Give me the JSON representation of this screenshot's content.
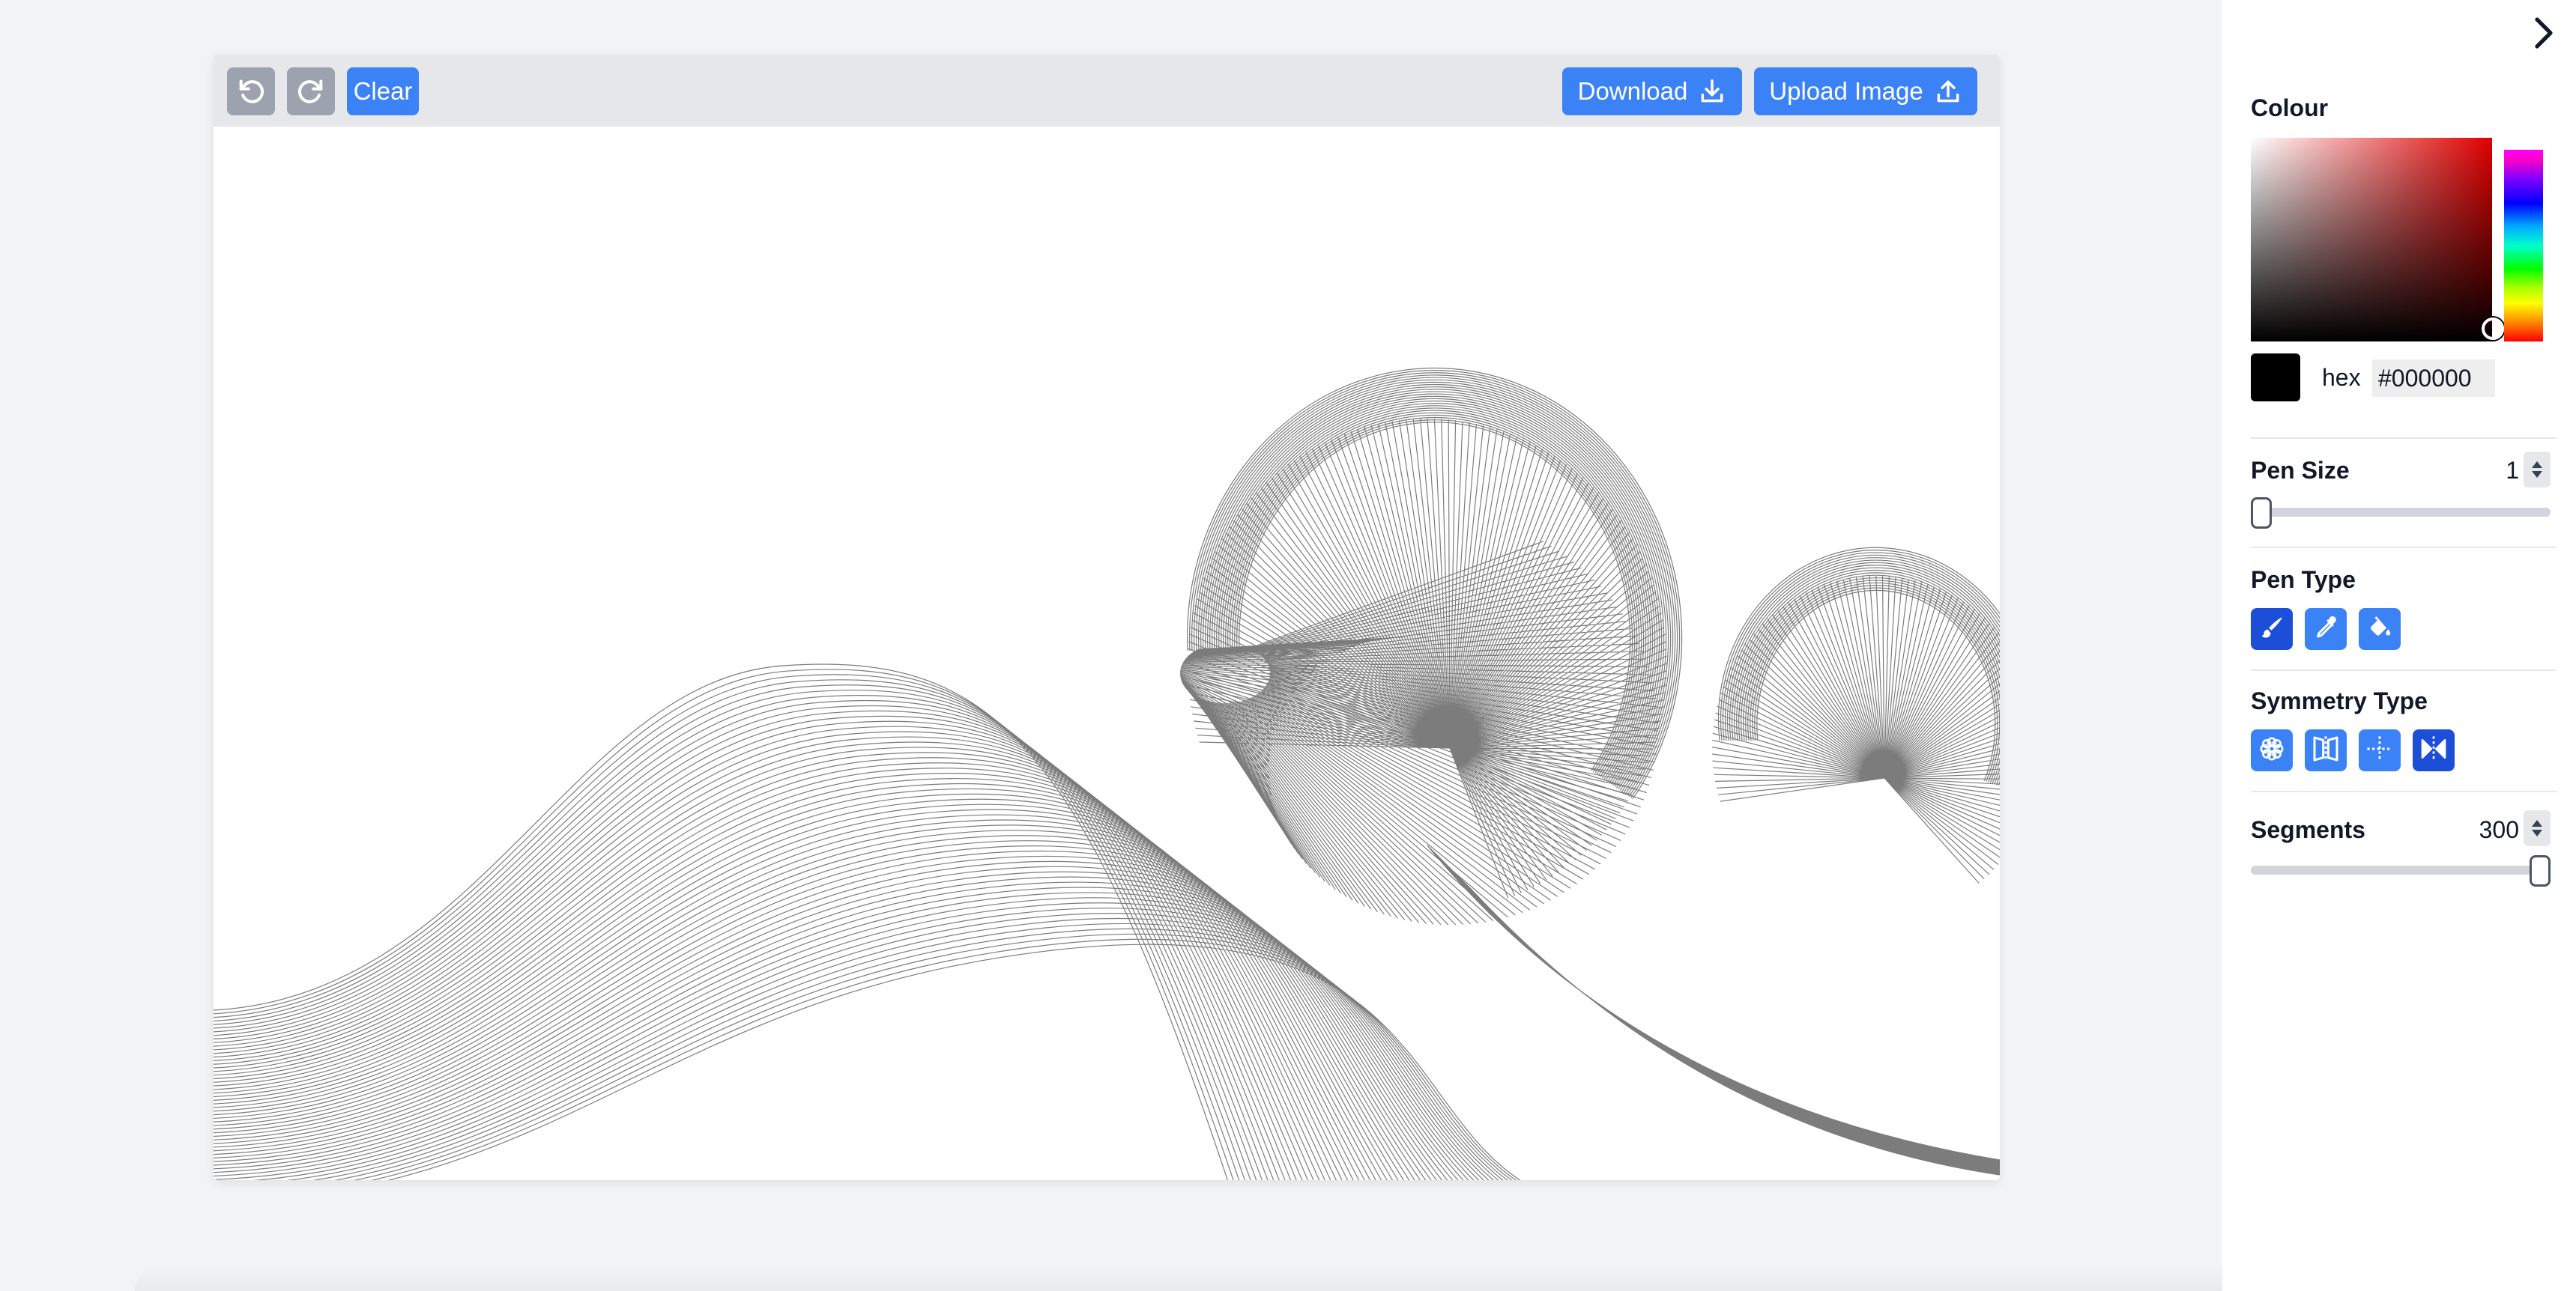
{
  "toolbar": {
    "undo_icon": "undo-icon",
    "redo_icon": "redo-icon",
    "clear_label": "Clear",
    "download_label": "Download",
    "download_icon": "download-icon",
    "upload_label": "Upload Image",
    "upload_icon": "upload-icon"
  },
  "panel": {
    "collapse_icon": "chevron-right-icon",
    "colour": {
      "label": "Colour",
      "hex_label": "hex",
      "hex_value": "#000000",
      "swatch_color": "#000000"
    },
    "pen_size": {
      "label": "Pen Size",
      "value": "1"
    },
    "pen_type": {
      "label": "Pen Type",
      "tools": [
        "brush-icon",
        "eyedropper-icon",
        "fill-bucket-icon"
      ],
      "active": "brush-icon"
    },
    "symmetry_type": {
      "label": "Symmetry Type",
      "tools": [
        "radial-symmetry-icon",
        "vertical-mirror-icon",
        "quad-symmetry-icon",
        "horizontal-mirror-icon"
      ],
      "active": "horizontal-mirror-icon"
    },
    "segments": {
      "label": "Segments",
      "value": "300"
    }
  },
  "colors": {
    "accent": "#3b82f6",
    "accent_active": "#1d4ed8",
    "toolbar_bg": "#e5e7eb",
    "gray_button": "#9ca3af"
  }
}
